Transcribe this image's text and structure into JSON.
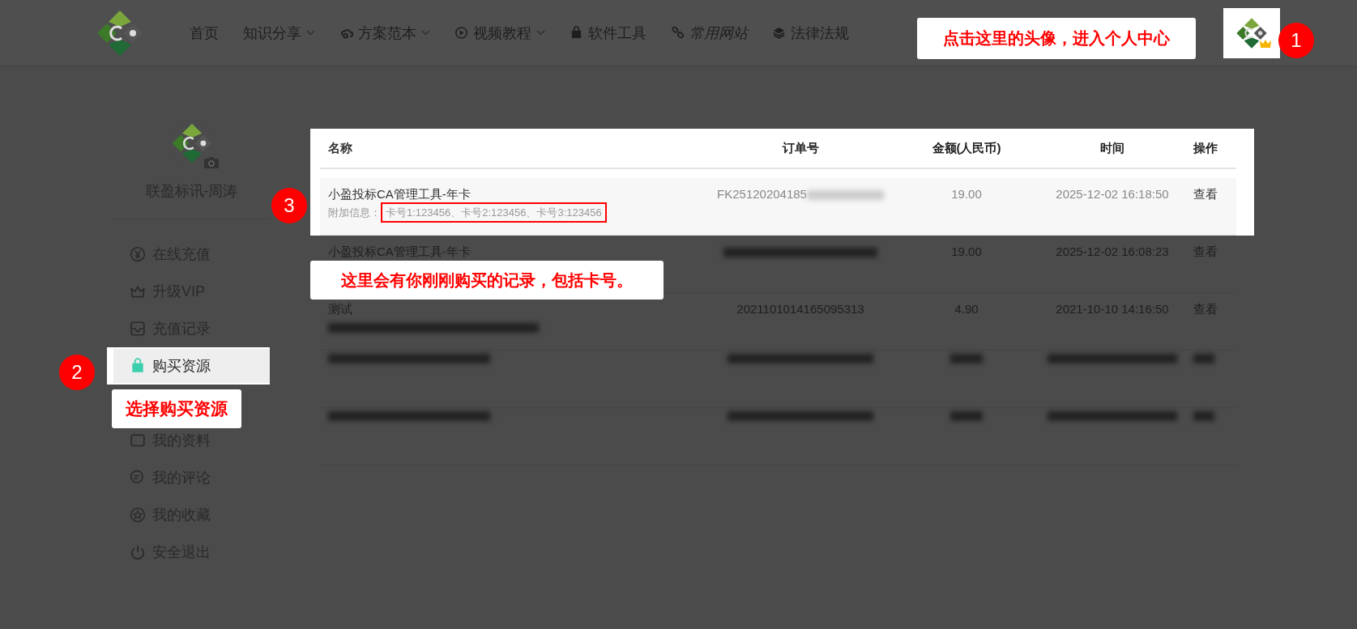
{
  "header": {
    "nav": [
      {
        "label": "首页",
        "dropdown": false,
        "italic": false
      },
      {
        "label": "知识分享",
        "dropdown": true,
        "italic": false
      },
      {
        "label": "方案范本",
        "dropdown": true,
        "italic": false
      },
      {
        "label": "视频教程",
        "dropdown": true,
        "italic": false
      },
      {
        "label": "软件工具",
        "dropdown": false,
        "italic": false
      },
      {
        "label": "常用网站",
        "dropdown": false,
        "italic": true
      },
      {
        "label": "法律法规",
        "dropdown": false,
        "italic": false
      }
    ]
  },
  "sidebar": {
    "user_name": "联盈标讯-周涛",
    "items": [
      {
        "label": "在线充值",
        "selected": false
      },
      {
        "label": "升级VIP",
        "selected": false
      },
      {
        "label": "充值记录",
        "selected": false
      },
      {
        "label": "购买资源",
        "selected": true
      },
      {
        "label": "我的资料",
        "selected": false
      },
      {
        "label": "我的评论",
        "selected": false
      },
      {
        "label": "我的收藏",
        "selected": false
      },
      {
        "label": "安全退出",
        "selected": false
      }
    ]
  },
  "table": {
    "columns": [
      "名称",
      "订单号",
      "金额(人民币)",
      "时间",
      "操作"
    ],
    "rows": [
      {
        "highlighted": true,
        "kind": "record",
        "name": "小盈投标CA管理工具-年卡",
        "note": {
          "kind": "text",
          "label": "附加信息：",
          "text": "卡号1:123456、卡号2:123456、卡号3:123456"
        },
        "order": {
          "kind": "partly_blurred",
          "text": "FK25120204185"
        },
        "amount": "19.00",
        "time": "2025-12-02 16:18:50",
        "action": "查看"
      },
      {
        "highlighted": false,
        "kind": "record",
        "name": "小盈投标CA管理工具-年卡",
        "order": {
          "kind": "blurred"
        },
        "amount": "19.00",
        "time": "2025-12-02 16:08:23",
        "action": "查看"
      },
      {
        "highlighted": false,
        "kind": "record",
        "name": "测试",
        "order": {
          "kind": "text",
          "text": "2021101014165095313"
        },
        "amount": "4.90",
        "time": "2021-10-10 14:16:50",
        "action": "查看",
        "note": {
          "kind": "blurred"
        }
      },
      {
        "highlighted": false,
        "kind": "blurred"
      },
      {
        "highlighted": false,
        "kind": "blurred"
      }
    ]
  },
  "annotations": [
    {
      "kind": "callout",
      "text": "点击这里的头像，进入个人中心"
    },
    {
      "kind": "badge",
      "text": "1"
    },
    {
      "kind": "badge",
      "text": "2"
    },
    {
      "kind": "callout",
      "text": "选择购买资源"
    },
    {
      "kind": "badge",
      "text": "3"
    },
    {
      "kind": "callout",
      "text": "这里会有你刚刚购买的记录，包括卡号。"
    }
  ]
}
